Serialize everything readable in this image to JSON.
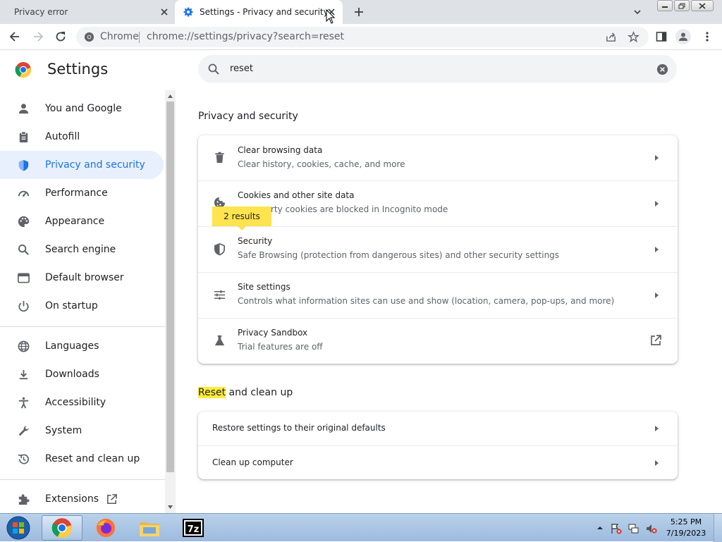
{
  "browser": {
    "tabs": [
      {
        "title": "Privacy error",
        "active": false
      },
      {
        "title": "Settings - Privacy and security",
        "active": true
      }
    ],
    "omnibox": {
      "chip": "Chrome",
      "url": "chrome://settings/privacy?search=reset"
    }
  },
  "settings": {
    "title": "Settings",
    "search": {
      "value": "reset"
    },
    "sidebar": {
      "items": [
        {
          "label": "You and Google",
          "icon": "person-icon"
        },
        {
          "label": "Autofill",
          "icon": "clipboard-icon"
        },
        {
          "label": "Privacy and security",
          "icon": "shield-icon",
          "selected": true
        },
        {
          "label": "Performance",
          "icon": "speedometer-icon"
        },
        {
          "label": "Appearance",
          "icon": "palette-icon"
        },
        {
          "label": "Search engine",
          "icon": "search-icon"
        },
        {
          "label": "Default browser",
          "icon": "browser-window-icon"
        },
        {
          "label": "On startup",
          "icon": "power-icon"
        },
        {
          "label": "Languages",
          "icon": "globe-icon"
        },
        {
          "label": "Downloads",
          "icon": "download-icon"
        },
        {
          "label": "Accessibility",
          "icon": "accessibility-icon"
        },
        {
          "label": "System",
          "icon": "wrench-icon"
        },
        {
          "label": "Reset and clean up",
          "icon": "history-icon"
        },
        {
          "label": "Extensions",
          "icon": "puzzle-icon"
        }
      ]
    },
    "privacy_section": {
      "title": "Privacy and security",
      "rows": [
        {
          "title": "Clear browsing data",
          "subtitle": "Clear history, cookies, cache, and more",
          "icon": "trash-icon"
        },
        {
          "title": "Cookies and other site data",
          "subtitle": "Third-party cookies are blocked in Incognito mode",
          "visible_subtitle": "rty cookies are blocked in Incognito mode",
          "icon": "cookie-icon"
        },
        {
          "title": "Security",
          "subtitle": "Safe Browsing (protection from dangerous sites) and other security settings",
          "icon": "shield-icon"
        },
        {
          "title": "Site settings",
          "subtitle": "Controls what information sites can use and show (location, camera, pop-ups, and more)",
          "icon": "sliders-icon"
        },
        {
          "title": "Privacy Sandbox",
          "subtitle": "Trial features are off",
          "icon": "flask-icon"
        }
      ],
      "results_bubble": "2 results"
    },
    "reset_section": {
      "title_highlight": "Reset",
      "title_rest": " and clean up",
      "rows": [
        {
          "title": "Restore settings to their original defaults"
        },
        {
          "title": "Clean up computer"
        }
      ]
    }
  },
  "taskbar": {
    "clock_time": "5:25 PM",
    "clock_date": "7/19/2023",
    "apps": [
      "chrome-icon",
      "firefox-icon",
      "file-explorer-icon",
      "7zip-icon"
    ]
  },
  "colors": {
    "accent": "#1a73e8",
    "selected_bg": "#e8f0fe",
    "highlight": "#ffeb3b",
    "tabstrip": "#dee1e6"
  }
}
